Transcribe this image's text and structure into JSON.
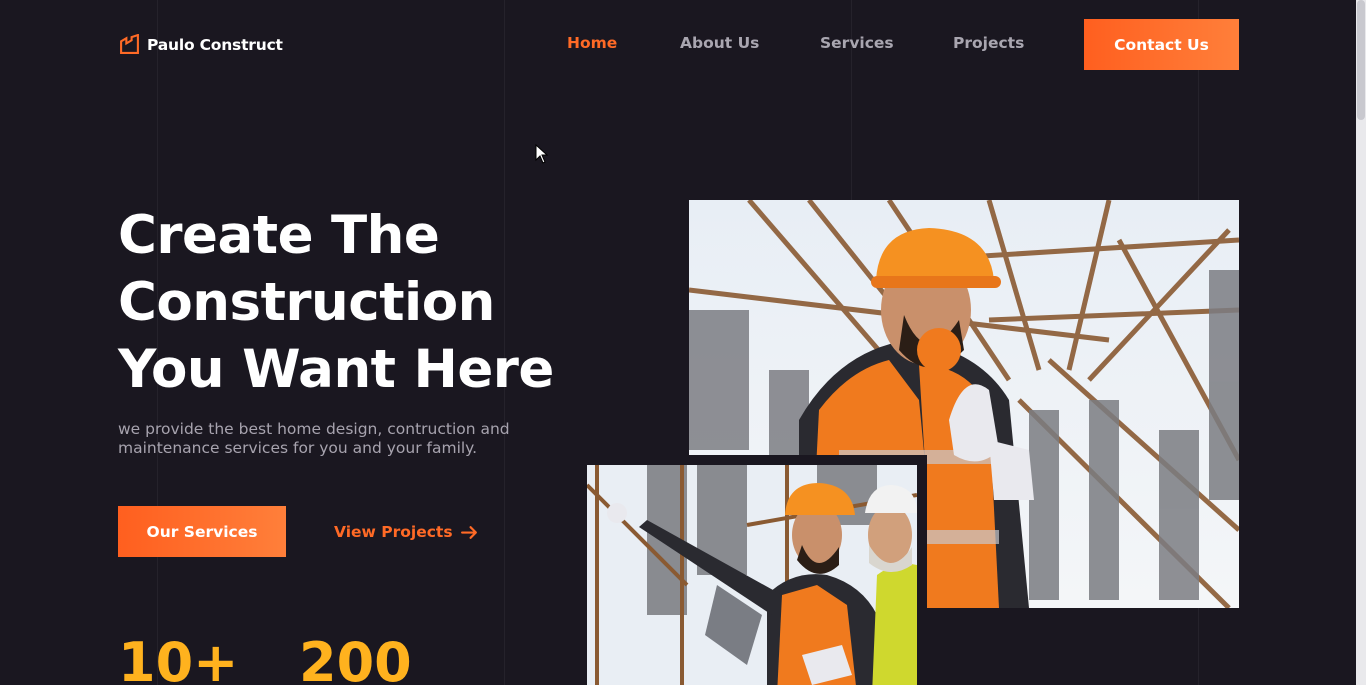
{
  "brand": {
    "name": "Paulo Construct",
    "logo_icon": "building-outline-icon",
    "accent": "#ff6a26"
  },
  "nav": {
    "items": [
      {
        "label": "Home",
        "active": true
      },
      {
        "label": "About Us",
        "active": false
      },
      {
        "label": "Services",
        "active": false
      },
      {
        "label": "Projects",
        "active": false
      }
    ],
    "cta": "Contact Us"
  },
  "hero": {
    "title_lines": [
      "Create The",
      "Construction",
      "You Want Here"
    ],
    "subtitle": "we provide the best home design, contruction and maintenance services for you and your family.",
    "primary_button": "Our Services",
    "secondary_link": "View Projects",
    "secondary_icon": "arrow-right-icon"
  },
  "stats": [
    "10+",
    "200"
  ],
  "images": {
    "main": "construction worker in orange hard hat and safety vest with ear protection",
    "secondary": "two construction workers pointing, one holding a tablet"
  },
  "colors": {
    "background": "#1a1720",
    "accent": "#ff6a26",
    "stat": "#ffb21e"
  }
}
